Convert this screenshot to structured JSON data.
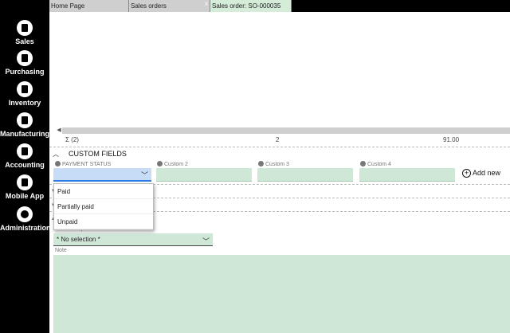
{
  "nav": {
    "items": [
      {
        "label": "Sales",
        "icon": "sales-icon"
      },
      {
        "label": "Purchasing",
        "icon": "purchasing-icon"
      },
      {
        "label": "Inventory",
        "icon": "inventory-icon"
      },
      {
        "label": "Manufacturing",
        "icon": "manufacturing-icon"
      },
      {
        "label": "Accounting",
        "icon": "accounting-icon"
      },
      {
        "label": "Mobile App",
        "icon": "mobile-icon"
      },
      {
        "label": "Administration",
        "icon": "gear-icon"
      }
    ]
  },
  "tabs": [
    {
      "label": "Home Page",
      "active": false
    },
    {
      "label": "Sales orders",
      "active": false
    },
    {
      "label": "Sales order: SO-000035",
      "active": true
    }
  ],
  "tab_close": "x",
  "grid": {
    "sum_label": "Σ (2)",
    "count_value": "2",
    "total_value": "91.00"
  },
  "custom_fields": {
    "title": "CUSTOM FIELDS",
    "payment_status_label": "PAYMENT STATUS",
    "custom2_label": "Custom 2",
    "custom3_label": "Custom 3",
    "custom4_label": "Custom 4",
    "add_new": "Add new"
  },
  "dropdown": {
    "options": [
      "Paid",
      "Partially paid",
      "Unpaid"
    ]
  },
  "notes": {
    "template_label": "Notes templates",
    "template_value": "* No selection *",
    "note_label": "Note"
  },
  "colors": {
    "nav_bg": "#000000",
    "field_bg": "#cfe7d6",
    "selected_field_bg": "#c6dcf7",
    "accent": "#2a7be4"
  }
}
